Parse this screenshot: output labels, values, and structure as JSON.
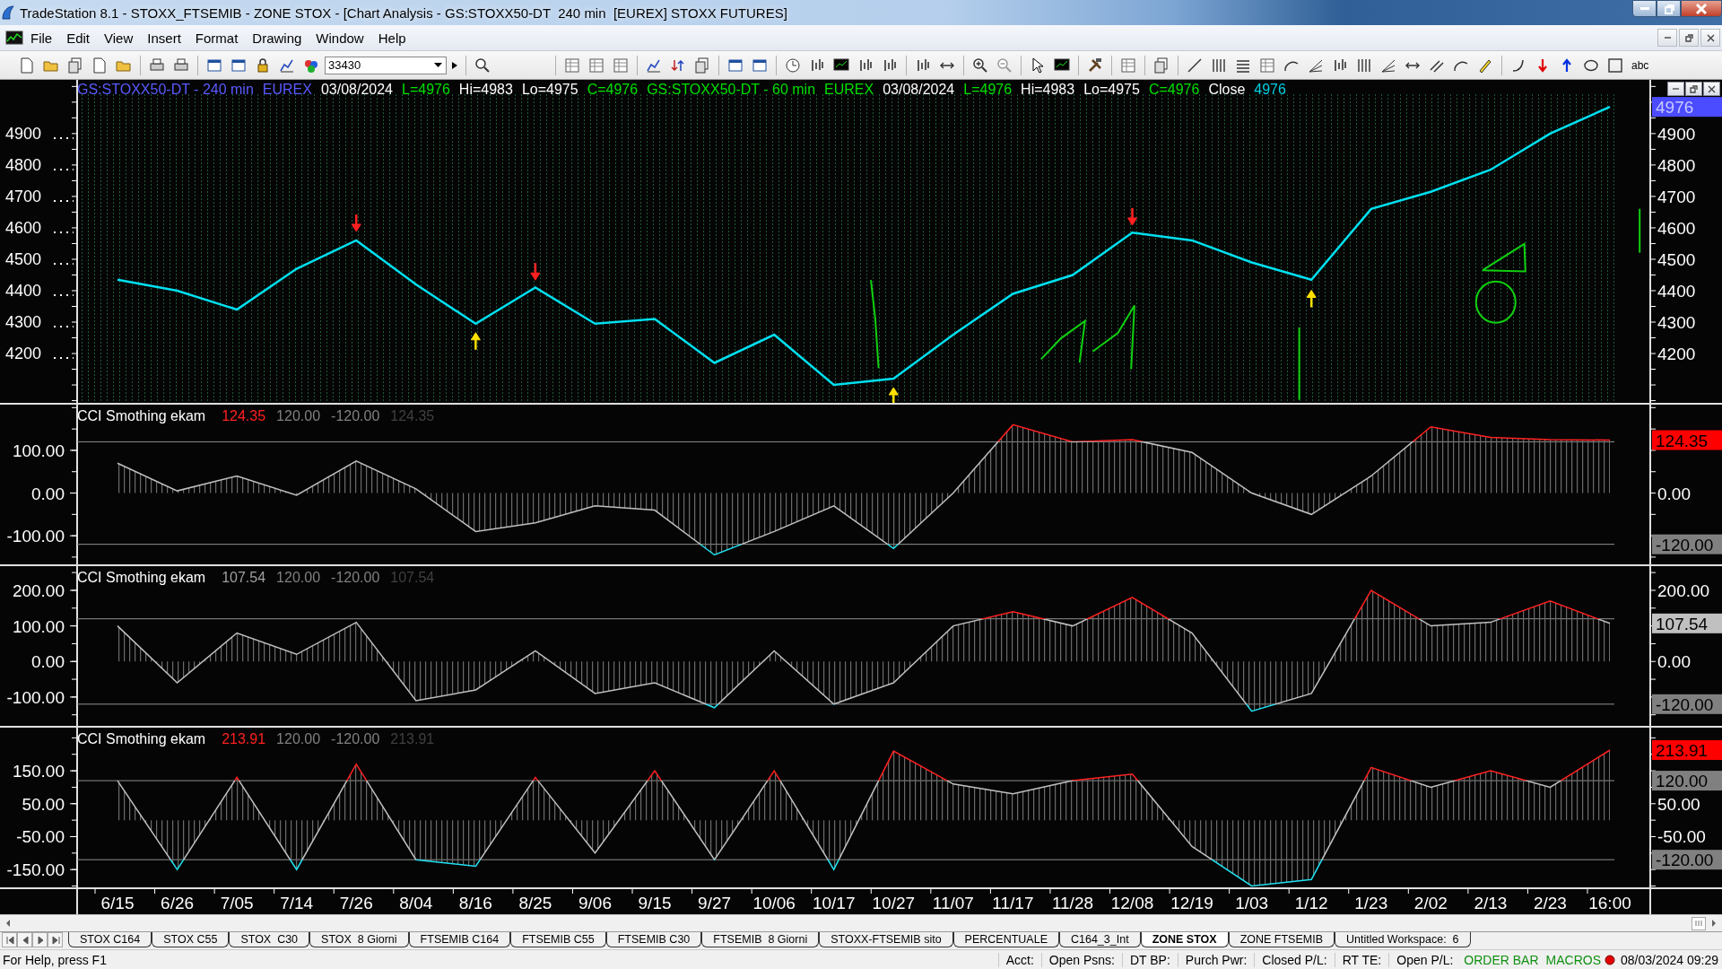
{
  "window": {
    "title": "TradeStation 8.1 - STOXX_FTSEMIB - ZONE STOX - [Chart Analysis - GS:STOXX50-DT  240 min  [EUREX] STOXX FUTURES]"
  },
  "menu": [
    "File",
    "Edit",
    "View",
    "Insert",
    "Format",
    "Drawing",
    "Window",
    "Help"
  ],
  "toolbar": {
    "symbol_box": {
      "value": "33430"
    },
    "text_tool": "abc"
  },
  "price_pane": {
    "legend": [
      {
        "text": "EUREX",
        "color": "#5a5aff"
      },
      {
        "text": "03/08/2024",
        "color": "#ffffff"
      },
      {
        "text": "L=4976",
        "color": "#00e000"
      },
      {
        "text": "Hi=4983",
        "color": "#ffffff"
      },
      {
        "text": "Lo=4975",
        "color": "#ffffff"
      },
      {
        "text": "C=4976",
        "color": "#00e000"
      },
      {
        "text": "GS:STOXX50-DT - 60 min",
        "color": "#00e000"
      },
      {
        "text": "EUREX",
        "color": "#00e000"
      },
      {
        "text": "03/08/2024",
        "color": "#ffffff"
      },
      {
        "text": "L=4976",
        "color": "#00e000"
      },
      {
        "text": "Hi=4983",
        "color": "#ffffff"
      },
      {
        "text": "Lo=4975",
        "color": "#ffffff"
      },
      {
        "text": "C=4976",
        "color": "#00e000"
      },
      {
        "text": "Close",
        "color": "#ffffff"
      },
      {
        "text": "4976",
        "color": "#00d0e0"
      }
    ],
    "chart_data": {
      "type": "line",
      "series": [
        {
          "name": "GS:STOXX50-DT - 240 min",
          "color": "#00e0f0",
          "values": [
            4435,
            4400,
            4340,
            4470,
            4560,
            4420,
            4295,
            4410,
            4295,
            4310,
            4170,
            4260,
            4100,
            4120,
            4260,
            4390,
            4450,
            4585,
            4560,
            4490,
            4435,
            4660,
            4715,
            4785,
            4900,
            4985
          ]
        },
        {
          "color": "#ff2020",
          "marker": "triangle",
          "values": [
            null,
            null,
            null,
            null,
            4600,
            null,
            null,
            4445,
            null,
            null,
            null,
            null,
            null,
            null,
            null,
            null,
            null,
            4620,
            null,
            null,
            null,
            null,
            null,
            null,
            null,
            null
          ]
        },
        {
          "color": "#ffe000",
          "marker": "triangle",
          "values": [
            null,
            null,
            null,
            null,
            null,
            null,
            4255,
            null,
            null,
            null,
            null,
            null,
            null,
            4080,
            null,
            null,
            null,
            null,
            null,
            null,
            4390,
            null,
            null,
            null,
            null,
            null
          ]
        }
      ],
      "ylim": [
        4043,
        5071
      ],
      "yticks": [
        {
          "value": 4900,
          "label": "4900"
        },
        {
          "value": 4800,
          "label": "4800"
        },
        {
          "value": 4700,
          "label": "4700"
        },
        {
          "value": 4600,
          "label": "4600"
        },
        {
          "value": 4500,
          "label": "4500"
        },
        {
          "value": 4400,
          "label": "4400"
        },
        {
          "value": 4300,
          "label": "4300"
        },
        {
          "value": 4200,
          "label": "4200"
        }
      ]
    },
    "right_axis": {
      "labels": [
        "4900",
        "4800",
        "4700",
        "4600",
        "4500",
        "4400",
        "4300",
        "4200"
      ]
    },
    "value_badges": [
      {
        "kind": "last",
        "text": "4976",
        "color": "#4b4bff"
      }
    ]
  },
  "cci_panes": [
    {
      "legend": [
        {
          "text": "124.35",
          "color": "#ff2020"
        },
        {
          "text": "124.35",
          "color": "#404040"
        }
      ],
      "chart_data": {
        "type": "area",
        "series": [
          {
            "name": "CCI Smothing ekam",
            "color": "#c0c0c0",
            "values": [
              70,
              5,
              40,
              -5,
              75,
              10,
              -90,
              -70,
              -30,
              -40,
              -145,
              -90,
              -30,
              -130,
              0,
              160,
              120,
              125,
              95,
              0,
              -50,
              40,
              155,
              130,
              125,
              124
            ]
          }
        ],
        "ylim": [
          -167,
          207
        ],
        "yticks": [
          {
            "value": 100,
            "label": "100.00"
          },
          {
            "value": 0,
            "label": "0.00"
          },
          {
            "value": -100,
            "label": "-100.00"
          }
        ],
        "ref_lines": [
          {
            "axis": "y",
            "value": 120,
            "label": "120.00"
          },
          {
            "axis": "y",
            "value": -120,
            "label": "-120.00"
          }
        ]
      },
      "right_axis": {
        "labels": [
          "0.00"
        ]
      },
      "value_badges": [
        {
          "kind": "last",
          "text": "124.35",
          "color": "#ff0000"
        },
        {
          "kind": "lower",
          "text": "-120.00",
          "color": "#808080"
        }
      ]
    },
    {
      "legend": [
        {
          "text": "107.54",
          "color": "#a0a0a0"
        },
        {
          "text": "107.54",
          "color": "#404040"
        }
      ],
      "chart_data": {
        "type": "area",
        "series": [
          {
            "name": "CCI Smothing ekam",
            "color": "#c0c0c0",
            "values": [
              100,
              -60,
              80,
              20,
              110,
              -110,
              -80,
              30,
              -90,
              -60,
              -130,
              30,
              -120,
              -60,
              100,
              140,
              100,
              180,
              80,
              -140,
              -90,
              200,
              100,
              110,
              170,
              107
            ]
          }
        ],
        "ylim": [
          -181,
          268
        ],
        "yticks": [
          {
            "value": 200,
            "label": "200.00"
          },
          {
            "value": 100,
            "label": "100.00"
          },
          {
            "value": 0,
            "label": "0.00"
          },
          {
            "value": -100,
            "label": "-100.00"
          }
        ],
        "ref_lines": [
          {
            "axis": "y",
            "value": 120,
            "label": "120.00"
          },
          {
            "axis": "y",
            "value": -120,
            "label": "-120.00"
          }
        ]
      },
      "right_axis": {
        "labels": [
          "200.00",
          "0.00"
        ]
      },
      "value_badges": [
        {
          "kind": "last",
          "text": "107.54",
          "color": "#c0c0c0"
        },
        {
          "kind": "lower",
          "text": "-120.00",
          "color": "#808080"
        }
      ]
    },
    {
      "legend": [
        {
          "text": "213.91",
          "color": "#ff2020"
        },
        {
          "text": "213.91",
          "color": "#404040"
        }
      ],
      "chart_data": {
        "type": "area",
        "categories": [
          "6/15",
          "6/26",
          "7/05",
          "7/14",
          "7/26",
          "8/04",
          "8/16",
          "8/25",
          "9/06",
          "9/15",
          "9/27",
          "10/06",
          "10/17",
          "10/27",
          "11/07",
          "11/17",
          "11/28",
          "12/08",
          "12/19",
          "1/03",
          "1/12",
          "1/23",
          "2/02",
          "2/13",
          "2/23",
          "16:00"
        ],
        "series": [
          {
            "name": "CCI Smothing ekam",
            "color": "#c0c0c0",
            "values": [
              120,
              -150,
              130,
              -150,
              170,
              -120,
              -140,
              130,
              -100,
              150,
              -120,
              150,
              -150,
              210,
              110,
              80,
              120,
              140,
              -80,
              -200,
              -180,
              160,
              100,
              150,
              100,
              213
            ]
          }
        ],
        "ylim": [
          -204,
          281
        ],
        "yticks": [
          {
            "value": 150,
            "label": "150.00"
          },
          {
            "value": 50,
            "label": "50.00"
          },
          {
            "value": -50,
            "label": "-50.00"
          },
          {
            "value": -150,
            "label": "-150.00"
          }
        ],
        "ref_lines": [
          {
            "axis": "y",
            "value": 120,
            "label": "120.00"
          },
          {
            "axis": "y",
            "value": -120,
            "label": "-120.00"
          }
        ]
      },
      "right_axis": {
        "labels": [
          "50.00",
          "-50.00"
        ]
      },
      "value_badges": [
        {
          "kind": "last",
          "text": "213.91",
          "color": "#ff0000"
        },
        {
          "kind": "upper",
          "text": "120.00",
          "color": "#808080"
        },
        {
          "kind": "lower",
          "text": "-120.00",
          "color": "#808080"
        }
      ]
    }
  ],
  "workspace_tabs": [
    {
      "label": "STOX C164",
      "selected": false
    },
    {
      "label": "STOX C55",
      "selected": false
    },
    {
      "label": "STOX  C30",
      "selected": false
    },
    {
      "label": "STOX  8 Giorni",
      "selected": false
    },
    {
      "label": "FTSEMIB C164",
      "selected": false
    },
    {
      "label": "FTSEMIB C55",
      "selected": false
    },
    {
      "label": "FTSEMIB C30",
      "selected": false
    },
    {
      "label": "FTSEMIB  8 Giorni",
      "selected": false
    },
    {
      "label": "STOXX-FTSEMIB sito",
      "selected": false
    },
    {
      "label": "PERCENTUALE",
      "selected": false
    },
    {
      "label": "C164_3_Int",
      "selected": false
    },
    {
      "label": "ZONE STOX",
      "selected": true
    },
    {
      "label": "ZONE FTSEMIB",
      "selected": false
    },
    {
      "label": "Untitled Workspace:  6",
      "selected": false
    }
  ],
  "status_bar": {
    "help": "For Help, press F1",
    "fields": [
      "Acct:",
      "Open Psns:",
      "DT BP:",
      "Purch Pwr:",
      "Closed P/L:",
      "RT TE:",
      "Open P/L:"
    ],
    "indicators": [
      "ORDER BAR",
      "MACROS"
    ],
    "clock": "08/03/2024 09:29"
  }
}
